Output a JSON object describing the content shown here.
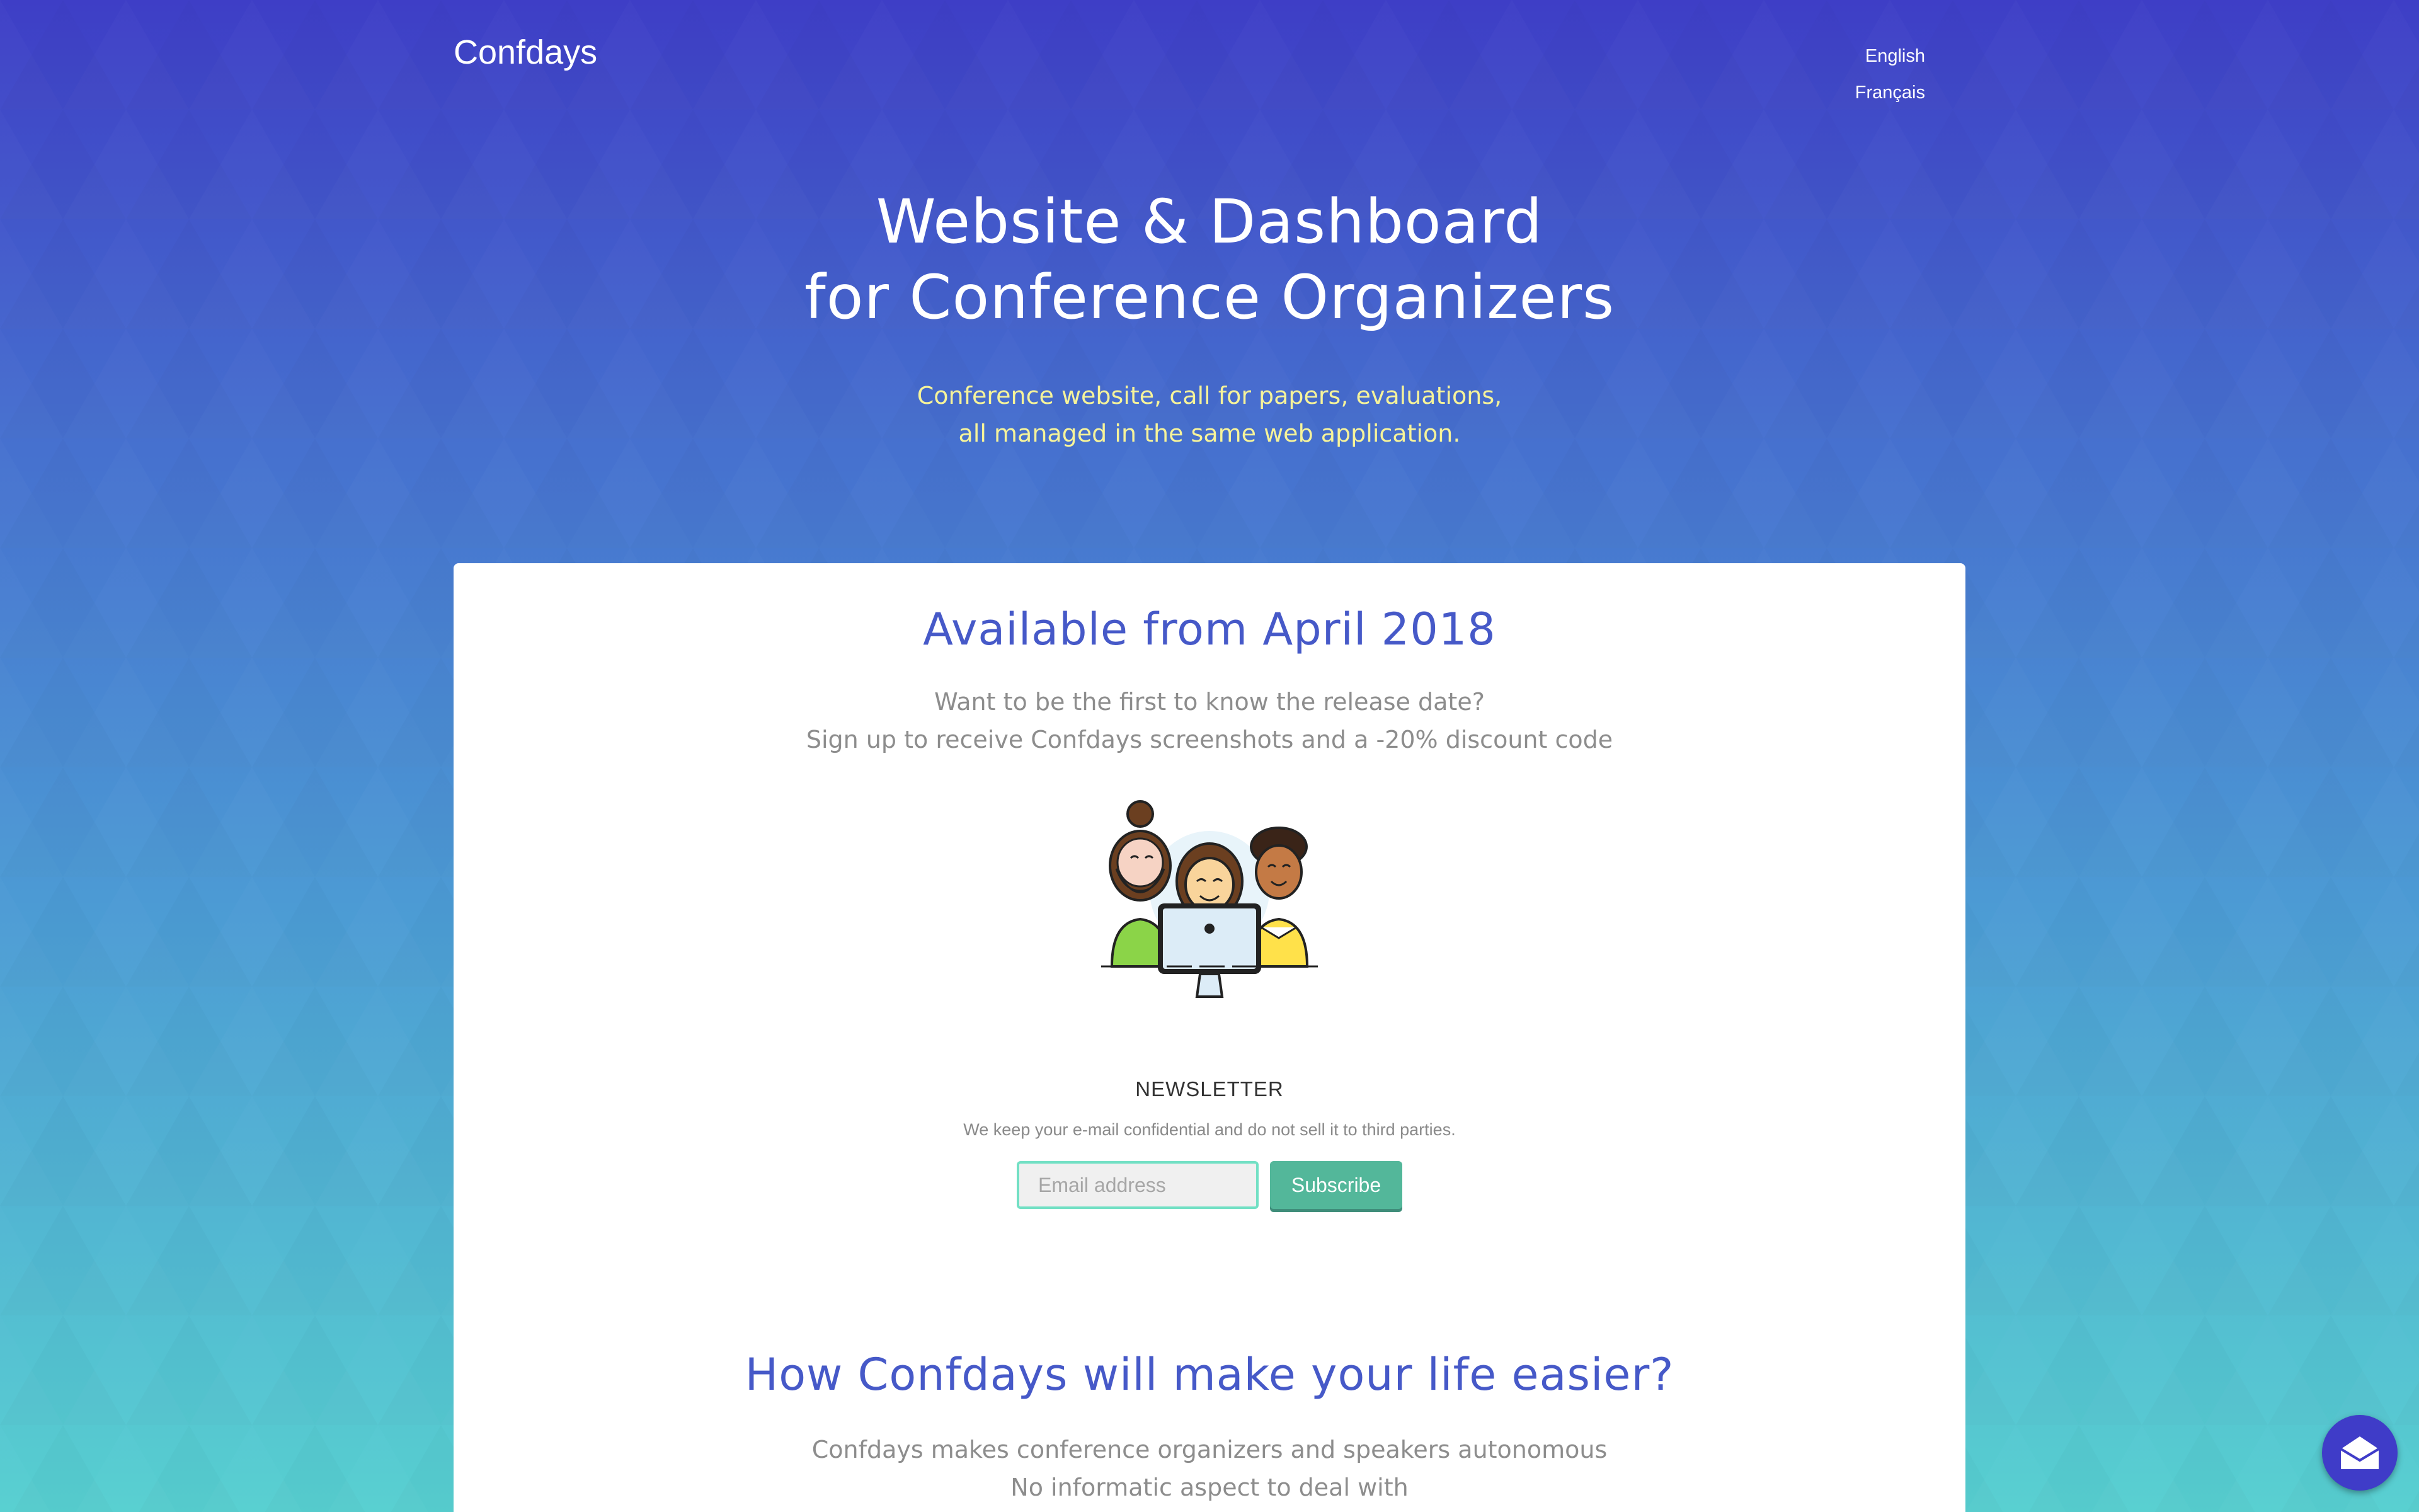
{
  "header": {
    "logo": "Confdays",
    "languages": [
      "English",
      "Français"
    ]
  },
  "hero": {
    "title_line1": "Website & Dashboard",
    "title_line2": "for Conference Organizers",
    "subtitle_line1": "Conference website, call for papers, evaluations,",
    "subtitle_line2": "all managed in the same web application."
  },
  "availability": {
    "title": "Available from April 2018",
    "line1": "Want to be the first to know the release date?",
    "line2": "Sign up to receive Confdays screenshots and a -20% discount code"
  },
  "newsletter": {
    "title": "NEWSLETTER",
    "note": "We keep your e-mail confidential and do not sell it to third parties.",
    "email_placeholder": "Email address",
    "subscribe_label": "Subscribe"
  },
  "features": {
    "title": "How Confdays will make your life easier?",
    "line1": "Confdays makes conference organizers and speakers autonomous",
    "line2": "No informatic aspect to deal with"
  },
  "icons": {
    "illustration": "team-at-computer-illustration",
    "chat": "mail-icon"
  },
  "colors": {
    "accent": "#4659c8",
    "subscribe": "#53b79a",
    "hero_subtitle": "#f6f39a",
    "fab": "#3f3cc8"
  }
}
